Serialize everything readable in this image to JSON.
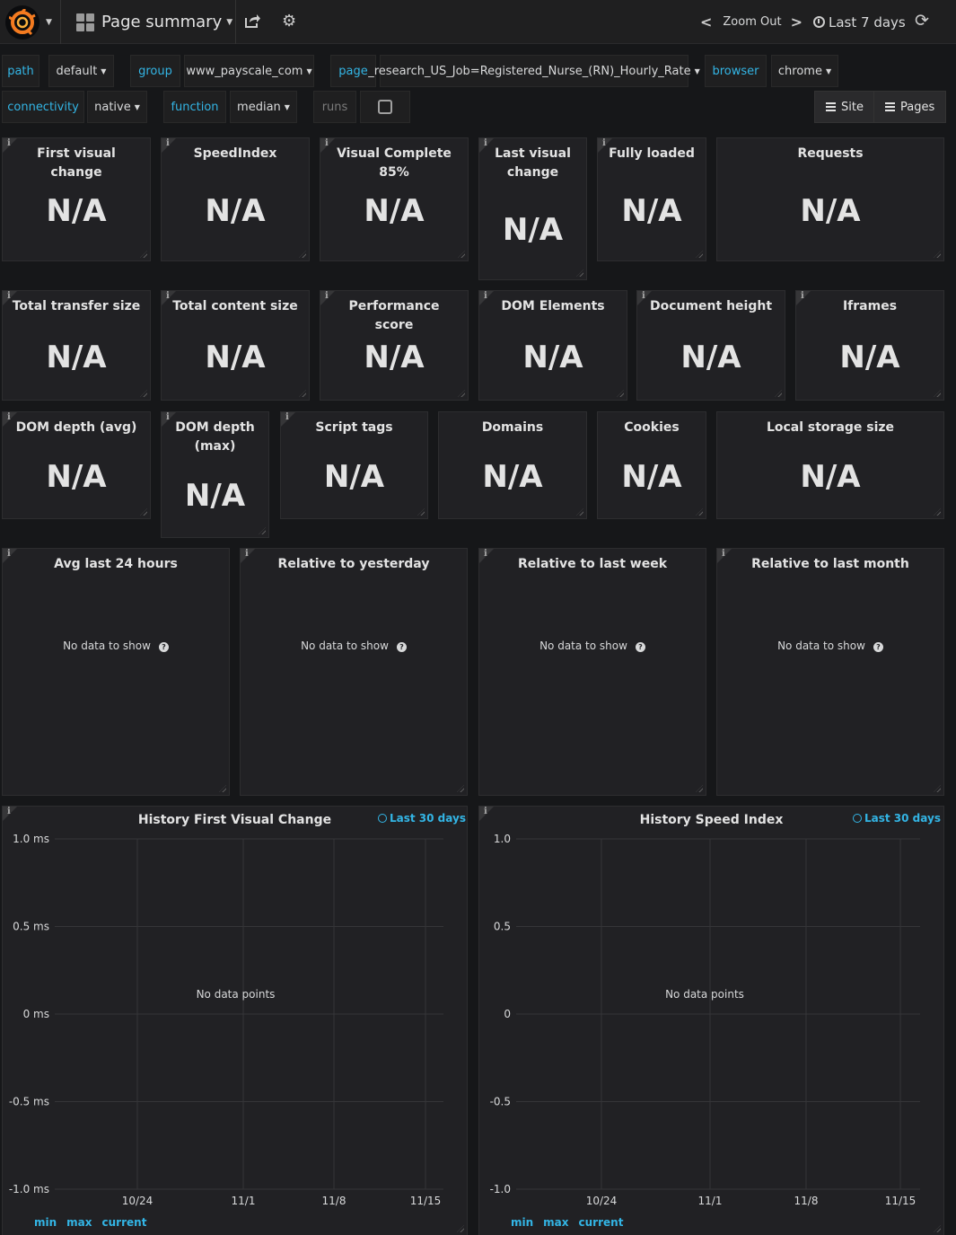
{
  "navbar": {
    "dashboard_title": "Page summary",
    "zoom_label": "Zoom Out",
    "time_range": "Last 7 days"
  },
  "variables": {
    "path": {
      "label": "path",
      "value": "default"
    },
    "group": {
      "label": "group",
      "value": "www_payscale_com"
    },
    "page": {
      "label": "page",
      "value": "_research_US_Job=Registered_Nurse_(RN)_Hourly_Rate"
    },
    "browser": {
      "label": "browser",
      "value": "chrome"
    },
    "connectivity": {
      "label": "connectivity",
      "value": "native"
    },
    "function": {
      "label": "function",
      "value": "median"
    },
    "runs": {
      "label": "runs",
      "checked": false
    }
  },
  "dash_links": {
    "site": "Site",
    "pages": "Pages"
  },
  "stats_row1": [
    {
      "title": "First visual change",
      "value": "N/A"
    },
    {
      "title": "SpeedIndex",
      "value": "N/A"
    },
    {
      "title": "Visual Complete 85%",
      "value": "N/A"
    },
    {
      "title": "Last visual change",
      "value": "N/A"
    },
    {
      "title": "Fully loaded",
      "value": "N/A"
    },
    {
      "title": "Requests",
      "value": "N/A"
    }
  ],
  "stats_row2": [
    {
      "title": "Total transfer size",
      "value": "N/A"
    },
    {
      "title": "Total content size",
      "value": "N/A"
    },
    {
      "title": "Performance score",
      "value": "N/A"
    },
    {
      "title": "DOM Elements",
      "value": "N/A"
    },
    {
      "title": "Document height",
      "value": "N/A"
    },
    {
      "title": "Iframes",
      "value": "N/A"
    }
  ],
  "stats_row3": [
    {
      "title": "DOM depth (avg)",
      "value": "N/A"
    },
    {
      "title": "DOM depth (max)",
      "value": "N/A"
    },
    {
      "title": "Script tags",
      "value": "N/A"
    },
    {
      "title": "Domains",
      "value": "N/A"
    },
    {
      "title": "Cookies",
      "value": "N/A"
    },
    {
      "title": "Local storage size",
      "value": "N/A"
    }
  ],
  "compare_panels": [
    {
      "title": "Avg last 24 hours",
      "message": "No data to show"
    },
    {
      "title": "Relative to yesterday",
      "message": "No data to show"
    },
    {
      "title": "Relative to last week",
      "message": "No data to show"
    },
    {
      "title": "Relative to last month",
      "message": "No data to show"
    }
  ],
  "graphs": [
    {
      "title": "History First Visual Change",
      "time_info": "Last 30 days",
      "no_data": "No data points",
      "y_ticks": [
        "1.0 ms",
        "0.5 ms",
        "0 ms",
        "-0.5 ms",
        "-1.0 ms"
      ],
      "x_ticks": [
        "10/24",
        "11/1",
        "11/8",
        "11/15"
      ],
      "legend": [
        "min",
        "max",
        "current"
      ]
    },
    {
      "title": "History Speed Index",
      "time_info": "Last 30 days",
      "no_data": "No data points",
      "y_ticks": [
        "1.0",
        "0.5",
        "0",
        "-0.5",
        "-1.0"
      ],
      "x_ticks": [
        "10/24",
        "11/1",
        "11/8",
        "11/15"
      ],
      "legend": [
        "min",
        "max",
        "current"
      ]
    }
  ],
  "chart_data": [
    {
      "type": "line",
      "title": "History First Visual Change",
      "series": [],
      "ylim": [
        -1.0,
        1.0
      ],
      "yticks": [
        "1.0 ms",
        "0.5 ms",
        "0 ms",
        "-0.5 ms",
        "-1.0 ms"
      ],
      "xticks": [
        "10/24",
        "11/1",
        "11/8",
        "11/15"
      ],
      "grid": true
    },
    {
      "type": "line",
      "title": "History Speed Index",
      "series": [],
      "ylim": [
        -1.0,
        1.0
      ],
      "yticks": [
        "1.0",
        "0.5",
        "0",
        "-0.5",
        "-1.0"
      ],
      "xticks": [
        "10/24",
        "11/1",
        "11/8",
        "11/15"
      ],
      "grid": true
    }
  ],
  "colors": {
    "accent": "#33b5e5",
    "panel_bg": "#212124",
    "page_bg": "#161719"
  }
}
